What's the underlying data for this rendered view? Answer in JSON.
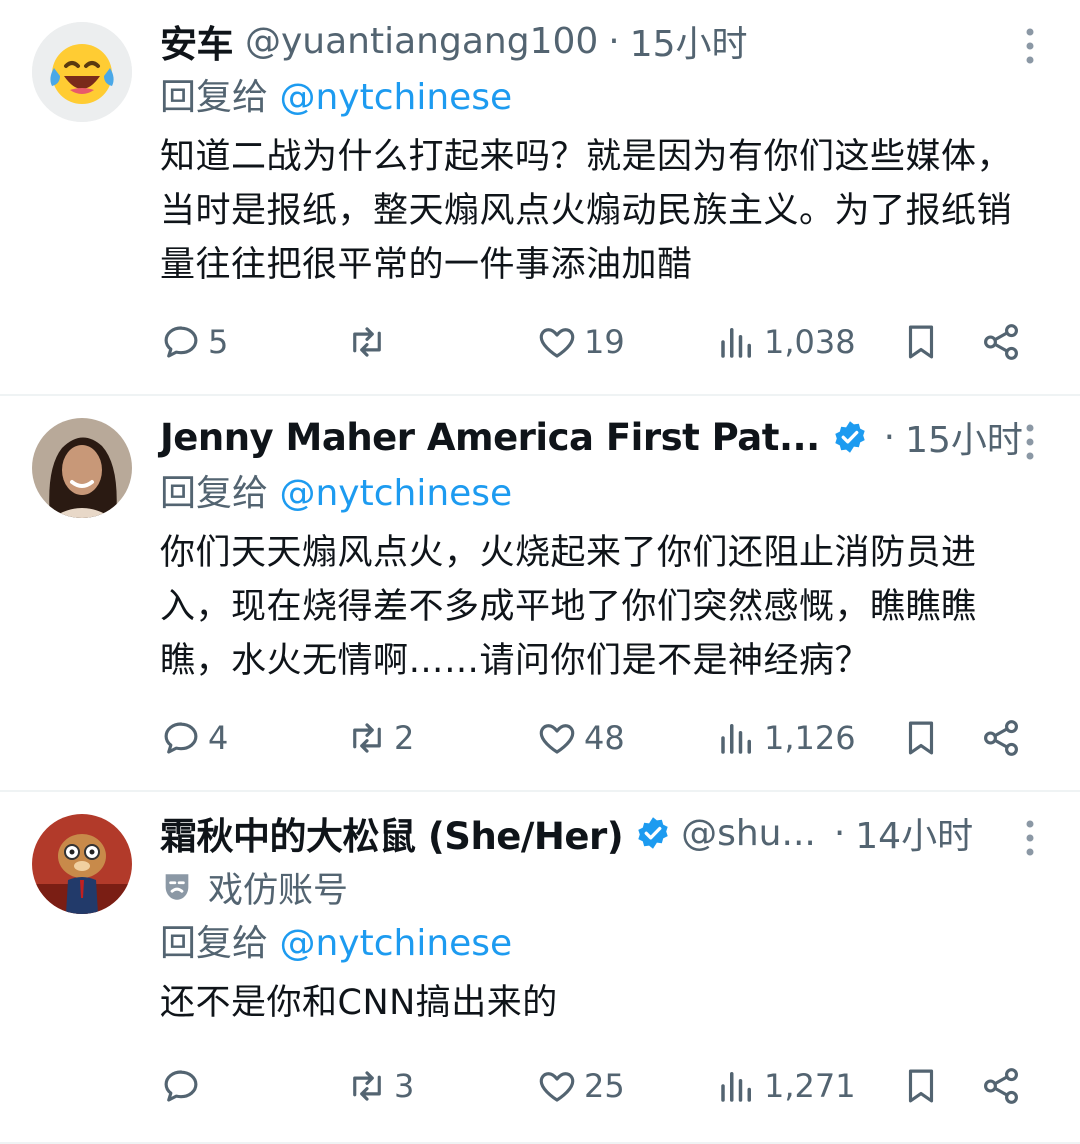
{
  "tweets": [
    {
      "name": "安车",
      "handle": "@yuantiangang100",
      "sep": "·",
      "time": "15小时",
      "reply_prefix": "回复给",
      "reply_to": "@nytchinese",
      "text": "知道二战为什么打起来吗？就是因为有你们这些媒体，当时是报纸，整天煽风点火煽动民族主义。为了报纸销量往往把很平常的一件事添油加醋",
      "replies": "5",
      "retweets": "",
      "likes": "19",
      "views": "1,038",
      "avatar": "laughing-emoji"
    },
    {
      "name": "Jenny Maher America First Pat...",
      "handle": "",
      "sep": "·",
      "time": "15小时",
      "verified": true,
      "reply_prefix": "回复给",
      "reply_to": "@nytchinese",
      "text": "你们天天煽风点火，火烧起来了你们还阻止消防员进入，现在烧得差不多成平地了你们突然感慨，瞧瞧瞧瞧，水火无情啊……请问你们是不是神经病？",
      "replies": "4",
      "retweets": "2",
      "likes": "48",
      "views": "1,126",
      "avatar": "woman-photo"
    },
    {
      "name": "霜秋中的大松鼠 (She/Her)",
      "handle": "@shu...",
      "sep": "·",
      "time": "14小时",
      "verified": true,
      "parody_label": "戏仿账号",
      "reply_prefix": "回复给",
      "reply_to": "@nytchinese",
      "text": "还不是你和CNN搞出来的",
      "replies": "",
      "retweets": "3",
      "likes": "25",
      "views": "1,271",
      "avatar": "squirrel-cartoon"
    }
  ],
  "colors": {
    "accent": "#1d9bf0",
    "muted": "#536471",
    "text": "#0f1419",
    "divider": "#eff3f4"
  }
}
